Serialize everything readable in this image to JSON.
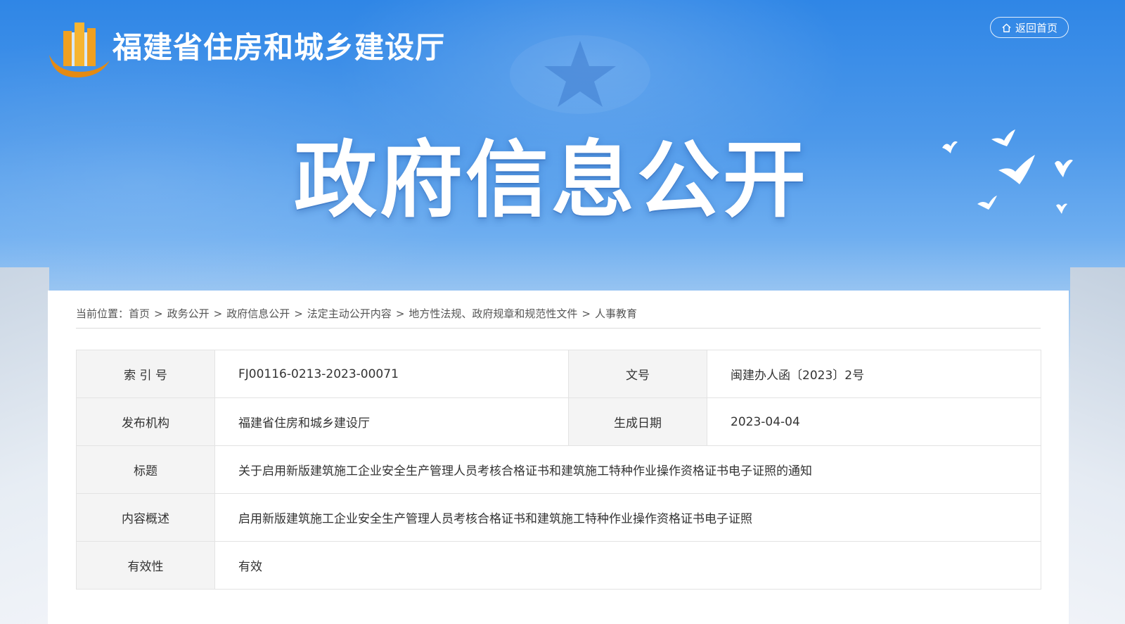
{
  "header": {
    "site_title": "福建省住房和城乡建设厅",
    "home_button_label": "返回首页",
    "hero_title": "政府信息公开"
  },
  "breadcrumb": {
    "prefix": "当前位置：",
    "separator": ">",
    "items": [
      "首页",
      "政务公开",
      "政府信息公开",
      "法定主动公开内容",
      "地方性法规、政府规章和规范性文件",
      "人事教育"
    ]
  },
  "info": {
    "index_label": "索 引 号",
    "index_value": "FJ00116-0213-2023-00071",
    "docno_label": "文号",
    "docno_value": "闽建办人函〔2023〕2号",
    "publisher_label": "发布机构",
    "publisher_value": "福建省住房和城乡建设厅",
    "date_label": "生成日期",
    "date_value": "2023-04-04",
    "title_label": "标题",
    "title_value": "关于启用新版建筑施工企业安全生产管理人员考核合格证书和建筑施工特种作业操作资格证书电子证照的通知",
    "summary_label": "内容概述",
    "summary_value": "启用新版建筑施工企业安全生产管理人员考核合格证书和建筑施工特种作业操作资格证书电子证照",
    "validity_label": "有效性",
    "validity_value": "有效"
  },
  "icons": {
    "logo": "building-emblem-icon",
    "home": "home-icon"
  },
  "colors": {
    "banner_top": "#2f86e6",
    "logo_orange": "#f0a020",
    "label_bg": "#f4f4f4",
    "text": "#333333"
  }
}
